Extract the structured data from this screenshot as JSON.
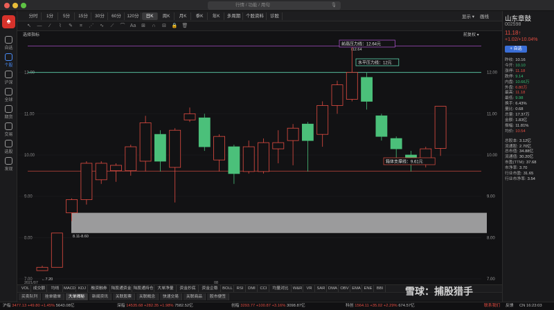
{
  "window": {
    "search_placeholder": "行情 / 功能 / 用句"
  },
  "sidebar": {
    "items": [
      {
        "label": "自选",
        "icon": "star-icon"
      },
      {
        "label": "个股",
        "icon": "chart-icon",
        "active": true
      },
      {
        "label": "沪深",
        "icon": "market-icon"
      },
      {
        "label": "全球",
        "icon": "globe-icon"
      },
      {
        "label": "期货",
        "icon": "futures-icon"
      },
      {
        "label": "交易",
        "icon": "trade-icon"
      },
      {
        "label": "选股",
        "icon": "filter-icon"
      },
      {
        "label": "发现",
        "icon": "discover-icon"
      }
    ]
  },
  "periods": [
    "分时",
    "1分",
    "5分",
    "15分",
    "30分",
    "60分",
    "120分",
    "日K",
    "周K",
    "月K",
    "季K",
    "年K",
    "多周期",
    "个股资料",
    "诊股"
  ],
  "period_active": "日K",
  "view": {
    "display": "显示 ▾",
    "draw": "画线"
  },
  "chart": {
    "indicator_select": "选择指标",
    "adjust": "前复权",
    "price_axis": [
      "12.00",
      "11.00",
      "10.00",
      "9.00",
      "8.00",
      "7.00"
    ],
    "date_labels": [
      "2021/07",
      "08"
    ],
    "annotations": {
      "prev_high": "前高压力线：12.64元",
      "prev_high_mark": "↑12.64",
      "horizontal": "水平压力线：12元",
      "support": "箱体支撑线：9.61元",
      "gap": "8.11-8.60",
      "low": "←7.20"
    }
  },
  "chart_data": {
    "type": "candlestick",
    "y_range": [
      7.0,
      12.9
    ],
    "candles": [
      {
        "o": 7.2,
        "c": 7.28,
        "h": 7.32,
        "l": 7.2
      },
      {
        "o": 7.28,
        "c": 8.11,
        "h": 8.11,
        "l": 7.28
      },
      {
        "o": 8.6,
        "c": 8.92,
        "h": 8.95,
        "l": 8.4
      },
      {
        "o": 8.92,
        "c": 9.8,
        "h": 9.85,
        "l": 8.8
      },
      {
        "o": 9.4,
        "c": 9.8,
        "h": 9.85,
        "l": 9.3
      },
      {
        "o": 9.62,
        "c": 9.75,
        "h": 9.8,
        "l": 9.35
      },
      {
        "o": 9.62,
        "c": 10.2,
        "h": 10.25,
        "l": 9.5
      },
      {
        "o": 9.85,
        "c": 10.78,
        "h": 10.95,
        "l": 9.6
      },
      {
        "o": 10.5,
        "c": 9.85,
        "h": 10.6,
        "l": 9.6
      },
      {
        "o": 9.7,
        "c": 10.6,
        "h": 10.65,
        "l": 8.85
      },
      {
        "o": 10.85,
        "c": 11.0,
        "h": 11.15,
        "l": 10.8
      },
      {
        "o": 10.9,
        "c": 10.2,
        "h": 11.0,
        "l": 10.1
      },
      {
        "o": 9.88,
        "c": 10.45,
        "h": 10.5,
        "l": 9.6
      },
      {
        "o": 10.2,
        "c": 9.55,
        "h": 10.25,
        "l": 9.3
      },
      {
        "o": 9.6,
        "c": 10.2,
        "h": 10.35,
        "l": 9.55
      },
      {
        "o": 9.6,
        "c": 10.3,
        "h": 10.4,
        "l": 9.55
      },
      {
        "o": 10.15,
        "c": 10.3,
        "h": 10.6,
        "l": 9.8
      },
      {
        "o": 10.35,
        "c": 10.65,
        "h": 10.75,
        "l": 9.75
      },
      {
        "o": 10.75,
        "c": 10.35,
        "h": 10.8,
        "l": 9.6
      },
      {
        "o": 10.5,
        "c": 11.2,
        "h": 11.3,
        "l": 10.2
      },
      {
        "o": 11.2,
        "c": 11.7,
        "h": 11.8,
        "l": 11.0
      },
      {
        "o": 11.35,
        "c": 12.0,
        "h": 12.64,
        "l": 11.3
      },
      {
        "o": 11.88,
        "c": 11.3,
        "h": 12.0,
        "l": 11.1
      },
      {
        "o": 10.95,
        "c": 10.45,
        "h": 11.0,
        "l": 10.35
      },
      {
        "o": 10.4,
        "c": 10.15,
        "h": 10.45,
        "l": 9.9
      },
      {
        "o": 10.0,
        "c": 9.8,
        "h": 10.1,
        "l": 9.6
      },
      {
        "o": 9.85,
        "c": 10.15,
        "h": 10.2,
        "l": 9.7
      },
      {
        "o": 10.16,
        "c": 11.18,
        "h": 11.18,
        "l": 9.98
      }
    ],
    "lines": {
      "prev_high": 12.64,
      "horizontal": 12.0,
      "support": 9.61
    },
    "gap_zone": [
      8.11,
      8.6
    ],
    "colors": {
      "up": "#e54d42",
      "down": "#4bc07a",
      "gap": "#b4b4b4"
    }
  },
  "indicators": [
    "VOL",
    "成交额",
    "均线",
    "MACD",
    "KDJ",
    "融资融券",
    "陆股通资金",
    "陆股通持仓",
    "大单净量",
    "资金抄底",
    "资金企稳",
    "BOLL",
    "RSI",
    "DMI",
    "CCI",
    "均量对比",
    "W&R",
    "VR",
    "SAR",
    "DMA",
    "OBV",
    "EMA",
    "ENE",
    "BBI"
  ],
  "bottom_tabs": [
    {
      "label": "买卖队列"
    },
    {
      "label": "挂单撤单"
    },
    {
      "label": "大单揭秘",
      "active": true
    },
    {
      "label": "新闻资讯"
    },
    {
      "label": "关联股票"
    },
    {
      "label": "关联概念"
    },
    {
      "label": "快速交易"
    },
    {
      "label": "关联商品"
    },
    {
      "label": "股市便签"
    }
  ],
  "status": {
    "items": [
      {
        "name": "沪指",
        "price": "3477.13",
        "chg": "+49.80",
        "pct": "+1.45%",
        "amount": "5643.08亿"
      },
      {
        "name": "深指",
        "price": "14535.68",
        "chg": "+282.35",
        "pct": "+1.98%",
        "amount": "7582.52亿"
      },
      {
        "name": "创指",
        "price": "3293.77",
        "chg": "+100.87",
        "pct": "+3.16%",
        "amount": "3098.87亿"
      },
      {
        "name": "科创",
        "price": "1564.11",
        "chg": "+35.02",
        "pct": "+2.29%",
        "amount": "674.57亿"
      }
    ],
    "contact": "联系我们",
    "feedback": "反馈",
    "time": "CN 16:23:03"
  },
  "watermark": "雪球：捕股猎手",
  "stock": {
    "name": "山东章鼓",
    "code": "002598",
    "price": "11.18↑",
    "change": "+1.02/+10.04%",
    "add_watchlist": "+ 自选",
    "quotes": [
      {
        "k": "昨收:",
        "v": "10.16",
        "c": "#cfcfcf"
      },
      {
        "k": "今开:",
        "v": "10.10",
        "c": "#36c476"
      },
      {
        "k": "涨停:",
        "v": "11.18",
        "c": "#e54d42"
      },
      {
        "k": "跌停:",
        "v": "9.14",
        "c": "#36c476"
      },
      {
        "k": "内盘:",
        "v": "10.66万",
        "c": "#36c476"
      },
      {
        "k": "外盘:",
        "v": "6.80万",
        "c": "#e54d42"
      },
      {
        "k": "最高:",
        "v": "11.18",
        "c": "#e54d42"
      },
      {
        "k": "最低:",
        "v": "9.98",
        "c": "#36c476"
      },
      {
        "k": "换手:",
        "v": "6.43%",
        "c": "#cfcfcf"
      },
      {
        "k": "量比:",
        "v": "0.68",
        "c": "#cfcfcf"
      },
      {
        "k": "总量:",
        "v": "17.37万",
        "c": "#cfcfcf"
      },
      {
        "k": "金额:",
        "v": "1.83亿",
        "c": "#cfcfcf"
      },
      {
        "k": "振幅:",
        "v": "11.81%",
        "c": "#cfcfcf"
      },
      {
        "k": "均价:",
        "v": "10.54",
        "c": "#e54d42"
      },
      {
        "k": "总股本:",
        "v": "3.12亿",
        "c": "#cfcfcf"
      },
      {
        "k": "流通股:",
        "v": "2.70亿",
        "c": "#cfcfcf"
      },
      {
        "k": "总市值:",
        "v": "34.88亿",
        "c": "#cfcfcf"
      },
      {
        "k": "流通值:",
        "v": "30.20亿",
        "c": "#cfcfcf"
      },
      {
        "k": "市盈(TTM):",
        "v": "37.68",
        "c": "#cfcfcf"
      },
      {
        "k": "市净率:",
        "v": "3.70",
        "c": "#cfcfcf"
      },
      {
        "k": "行业市盈:",
        "v": "31.65",
        "c": "#cfcfcf"
      },
      {
        "k": "行业市净率:",
        "v": "3.54",
        "c": "#cfcfcf"
      }
    ]
  }
}
